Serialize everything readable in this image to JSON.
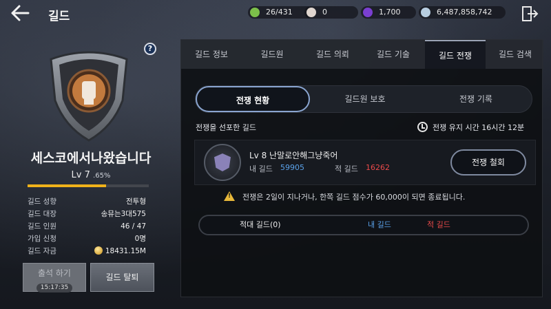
{
  "header": {
    "title": "길드"
  },
  "resources": [
    {
      "name": "guild-token",
      "value": "26/431",
      "color": "#7cc04a"
    },
    {
      "name": "pearl",
      "value": "0",
      "color": "#e0d6cf"
    },
    {
      "name": "purple-gem",
      "value": "1,700",
      "color": "#7a3fd0"
    },
    {
      "name": "silver",
      "value": "6,487,858,742",
      "color": "#b7cde0"
    }
  ],
  "guild": {
    "name": "세스코에서나왔습니다",
    "level_label": "Lv 7",
    "exp_label": ".65%",
    "exp_fraction": 0.65,
    "info": [
      {
        "key": "길드 성향",
        "value": "전투형"
      },
      {
        "key": "길드 대장",
        "value": "송뮤는3대575"
      },
      {
        "key": "길드 인원",
        "value": "46 / 47"
      },
      {
        "key": "가입 신청",
        "value": "0명"
      },
      {
        "key": "길드 자금",
        "value": "18431.15M"
      }
    ],
    "attend_label": "출석 하기",
    "attend_timer": "15:17:35",
    "leave_label": "길드 탈퇴"
  },
  "tabs": [
    "길드 정보",
    "길드원",
    "길드 의뢰",
    "길드 기술",
    "길드 전쟁",
    "길드 검색"
  ],
  "active_tab": "길드 전쟁",
  "sub_tabs": [
    "전쟁 현황",
    "길드원 보호",
    "전쟁 기록"
  ],
  "war": {
    "declared_label": "전쟁을 선포한 길드",
    "duration_label": "전쟁 유지 시간 16시간 12분",
    "enemy_name": "Lv 8 난말로안해그냥죽어",
    "my_guild_label": "내 길드",
    "my_score": "59905",
    "enemy_guild_label": "적 길드",
    "enemy_score": "16262",
    "withdraw_label": "전쟁 철회",
    "notice": "전쟁은 2일이 지나거나, 한쪽 길드 점수가 60,000이 되면 종료됩니다.",
    "list_header": {
      "enemy_col": "적대 길드(0)",
      "my_col": "내 길드",
      "enemy_guild_col": "적 길드"
    }
  }
}
